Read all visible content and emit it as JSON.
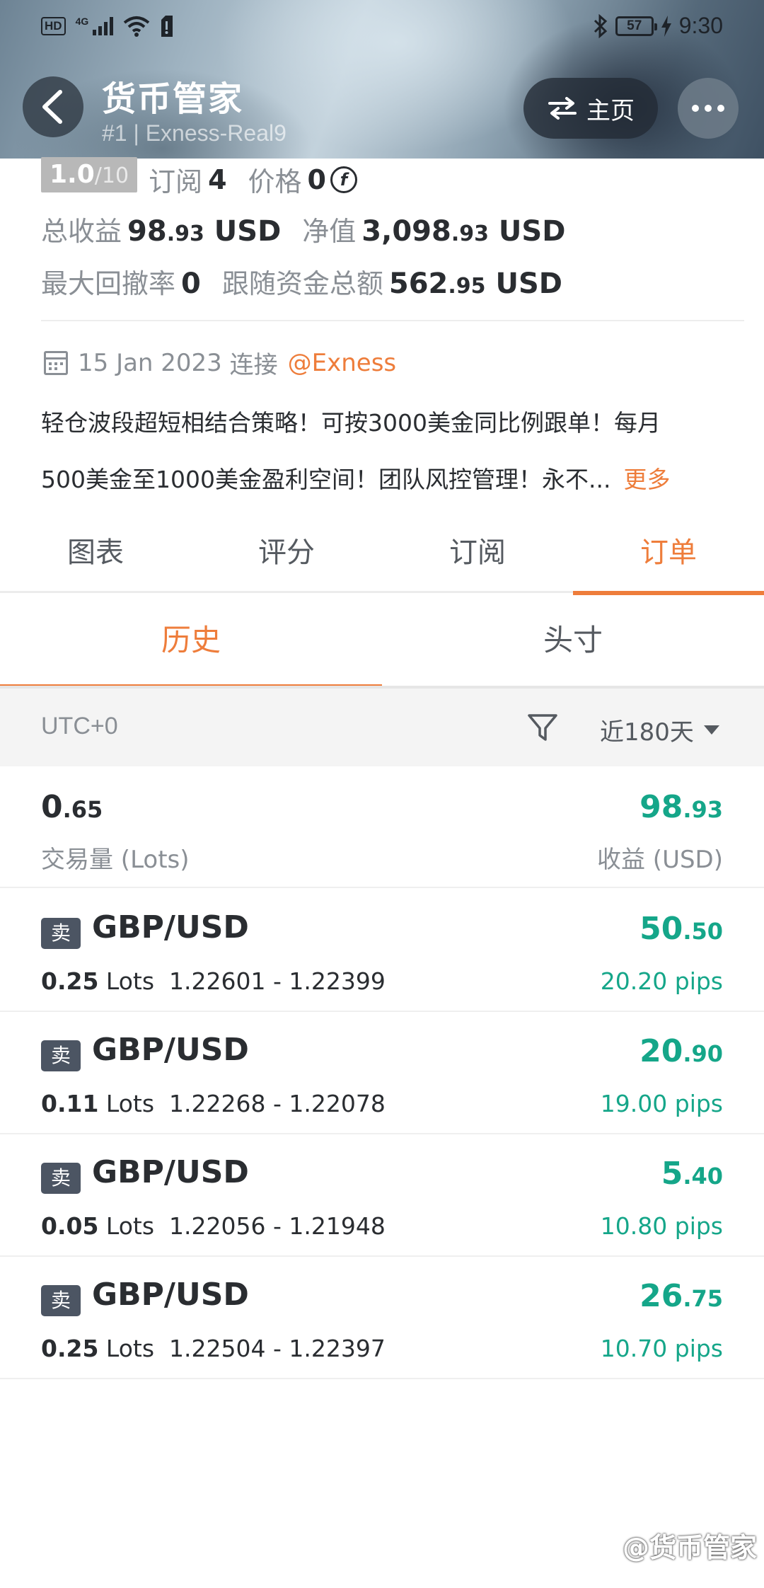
{
  "status_bar": {
    "hd": "HD",
    "network": "4G",
    "battery": "57",
    "time": "9:30"
  },
  "header": {
    "title": "货币管家",
    "subtitle": "#1 | Exness-Real9",
    "home_label": "主页",
    "icons": [
      "back-arrow-icon",
      "swap-arrows-icon",
      "more-dots-icon"
    ]
  },
  "summary": {
    "rating_num": "1.0",
    "rating_den": "/10",
    "subscribe_label": "订阅",
    "subscribe_value": "4",
    "price_label": "价格",
    "price_value": "0",
    "currency_symbol": "f",
    "total_profit_label": "总收益",
    "total_profit_int": "98",
    "total_profit_dec": ".93",
    "total_profit_unit": "USD",
    "equity_label": "净值",
    "equity_int": "3,098",
    "equity_dec": ".93",
    "equity_unit": "USD",
    "drawdown_label": "最大回撤率",
    "drawdown_value": "0",
    "follow_funds_label": "跟随资金总额",
    "follow_funds_int": "562",
    "follow_funds_dec": ".95",
    "follow_funds_unit": "USD"
  },
  "connection": {
    "date": "15 Jan 2023",
    "connect_label": "连接",
    "broker": "@Exness"
  },
  "description": {
    "line1": "轻仓波段超短相结合策略！可按3000美金同比例跟单！每月",
    "line2": "500美金至1000美金盈利空间！团队风控管理！永不...",
    "more": "更多"
  },
  "main_tabs": [
    {
      "label": "图表",
      "active": false
    },
    {
      "label": "评分",
      "active": false
    },
    {
      "label": "订阅",
      "active": false
    },
    {
      "label": "订单",
      "active": true
    }
  ],
  "sub_tabs": [
    {
      "label": "历史",
      "active": true
    },
    {
      "label": "头寸",
      "active": false
    }
  ],
  "filter": {
    "timezone": "UTC+0",
    "period": "近180天"
  },
  "totals": {
    "volume_int": "0",
    "volume_dec": ".65",
    "volume_label": "交易量 (Lots)",
    "profit_int": "98",
    "profit_dec": ".93",
    "profit_label": "收益 (USD)"
  },
  "orders": [
    {
      "side": "卖",
      "pair": "GBP/USD",
      "lots": "0.25",
      "lots_unit": "Lots",
      "range": "1.22601 - 1.22399",
      "profit_int": "50",
      "profit_dec": ".50",
      "pips": "20.20 pips"
    },
    {
      "side": "卖",
      "pair": "GBP/USD",
      "lots": "0.11",
      "lots_unit": "Lots",
      "range": "1.22268 - 1.22078",
      "profit_int": "20",
      "profit_dec": ".90",
      "pips": "19.00 pips"
    },
    {
      "side": "卖",
      "pair": "GBP/USD",
      "lots": "0.05",
      "lots_unit": "Lots",
      "range": "1.22056 - 1.21948",
      "profit_int": "5",
      "profit_dec": ".40",
      "pips": "10.80 pips"
    },
    {
      "side": "卖",
      "pair": "GBP/USD",
      "lots": "0.25",
      "lots_unit": "Lots",
      "range": "1.22504 - 1.22397",
      "profit_int": "26",
      "profit_dec": ".75",
      "pips": "10.70 pips"
    }
  ],
  "watermark": "@货币管家",
  "colors": {
    "accent": "#ee7d3b",
    "profit": "#15a689",
    "badge": "#4c5563"
  }
}
